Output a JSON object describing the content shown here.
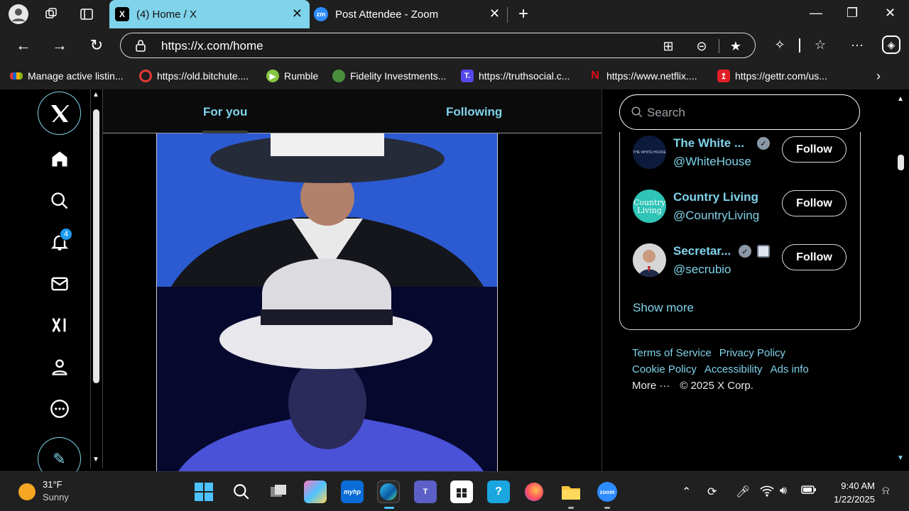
{
  "browser": {
    "tabs": [
      {
        "title": "(4) Home / X",
        "favicon": "X",
        "active": true
      },
      {
        "title": "Post Attendee - Zoom",
        "favicon": "zm",
        "active": false
      }
    ],
    "url": "https://x.com/home",
    "bookmarks": [
      {
        "label": "Manage active listin...",
        "color": "#e53935"
      },
      {
        "label": "https://old.bitchute....",
        "color": "#e53935"
      },
      {
        "label": "Rumble",
        "color": "#85c742"
      },
      {
        "label": "Fidelity Investments...",
        "color": "#4a8f3c"
      },
      {
        "label": "https://truthsocial.c...",
        "color": "#5448ee"
      },
      {
        "label": "https://www.netflix....",
        "color": "#e50914"
      },
      {
        "label": "https://gettr.com/us...",
        "color": "#e01f26"
      }
    ]
  },
  "x": {
    "notifications_count": "4",
    "feed_tabs": {
      "for_you": "For you",
      "following": "Following"
    },
    "search_placeholder": "Search",
    "who_to_follow": [
      {
        "name": "The White ...",
        "handle": "@WhiteHouse",
        "avatar_text": "THE WHITE HOUSE",
        "avatar_color": "#0c1a3b"
      },
      {
        "name": "Country Living",
        "handle": "@CountryLiving",
        "avatar_text": "Country Living",
        "avatar_color": "#2ec4b6"
      },
      {
        "name": "Secretar...",
        "handle": "@secrubio",
        "avatar_text": "",
        "avatar_color": "#c9c9c9"
      }
    ],
    "follow_label": "Follow",
    "show_more": "Show more",
    "footer": {
      "terms": "Terms of Service",
      "privacy": "Privacy Policy",
      "cookie": "Cookie Policy",
      "accessibility": "Accessibility",
      "ads": "Ads info",
      "more": "More ···",
      "copyright": "© 2025 X Corp."
    },
    "accent": "#7fd3ea"
  },
  "taskbar": {
    "weather_temp": "31°F",
    "weather_desc": "Sunny",
    "time": "9:40 AM",
    "date": "1/22/2025"
  }
}
